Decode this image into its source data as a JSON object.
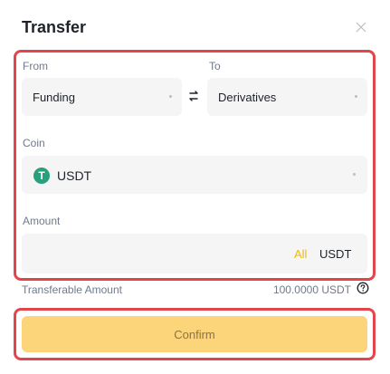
{
  "dialog": {
    "title": "Transfer"
  },
  "from": {
    "label": "From",
    "value": "Funding"
  },
  "to": {
    "label": "To",
    "value": "Derivatives"
  },
  "coin": {
    "label": "Coin",
    "icon_glyph": "T",
    "value": "USDT",
    "icon_color": "#26a17b"
  },
  "amount": {
    "label": "Amount",
    "all_label": "All",
    "unit": "USDT"
  },
  "transferable": {
    "label": "Transferable Amount",
    "value": "100.0000 USDT"
  },
  "confirm": {
    "label": "Confirm"
  },
  "colors": {
    "accent": "#f0b90b",
    "highlight_border": "#e2464a",
    "confirm_bg": "#fcd57a"
  },
  "icons": [
    "close-icon",
    "swap-icon",
    "tether-icon",
    "help-icon",
    "chevron-down-icon"
  ]
}
